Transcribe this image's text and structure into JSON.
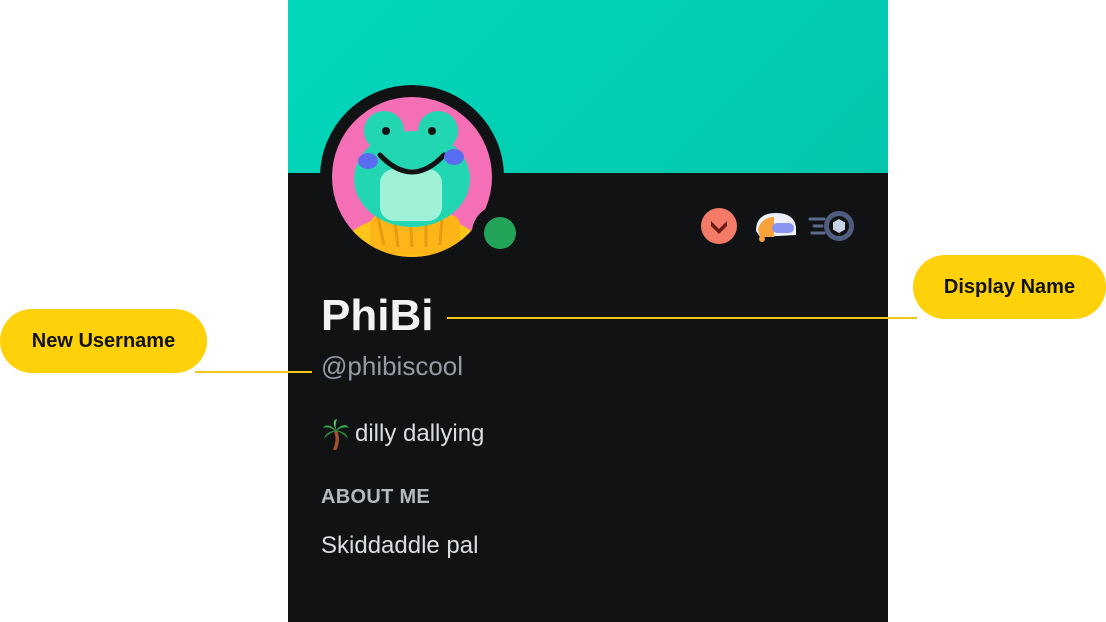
{
  "profile": {
    "display_name": "PhiBi",
    "username": "@phibiscool",
    "custom_status": {
      "emoji": "palm-tree-icon",
      "text": "dilly dallying"
    },
    "about_heading": "ABOUT ME",
    "about_text": "Skiddaddle pal",
    "online_status": "online",
    "badges": [
      "hypesquad-brilliance-badge-icon",
      "quest-helmet-badge-icon",
      "nitro-boost-badge-icon"
    ]
  },
  "annotations": {
    "display_name_label": "Display Name",
    "username_label": "New Username"
  },
  "colors": {
    "banner": "#00d8bb",
    "card_background": "#111214",
    "status_online": "#23a559",
    "callout": "#ffd10a"
  }
}
